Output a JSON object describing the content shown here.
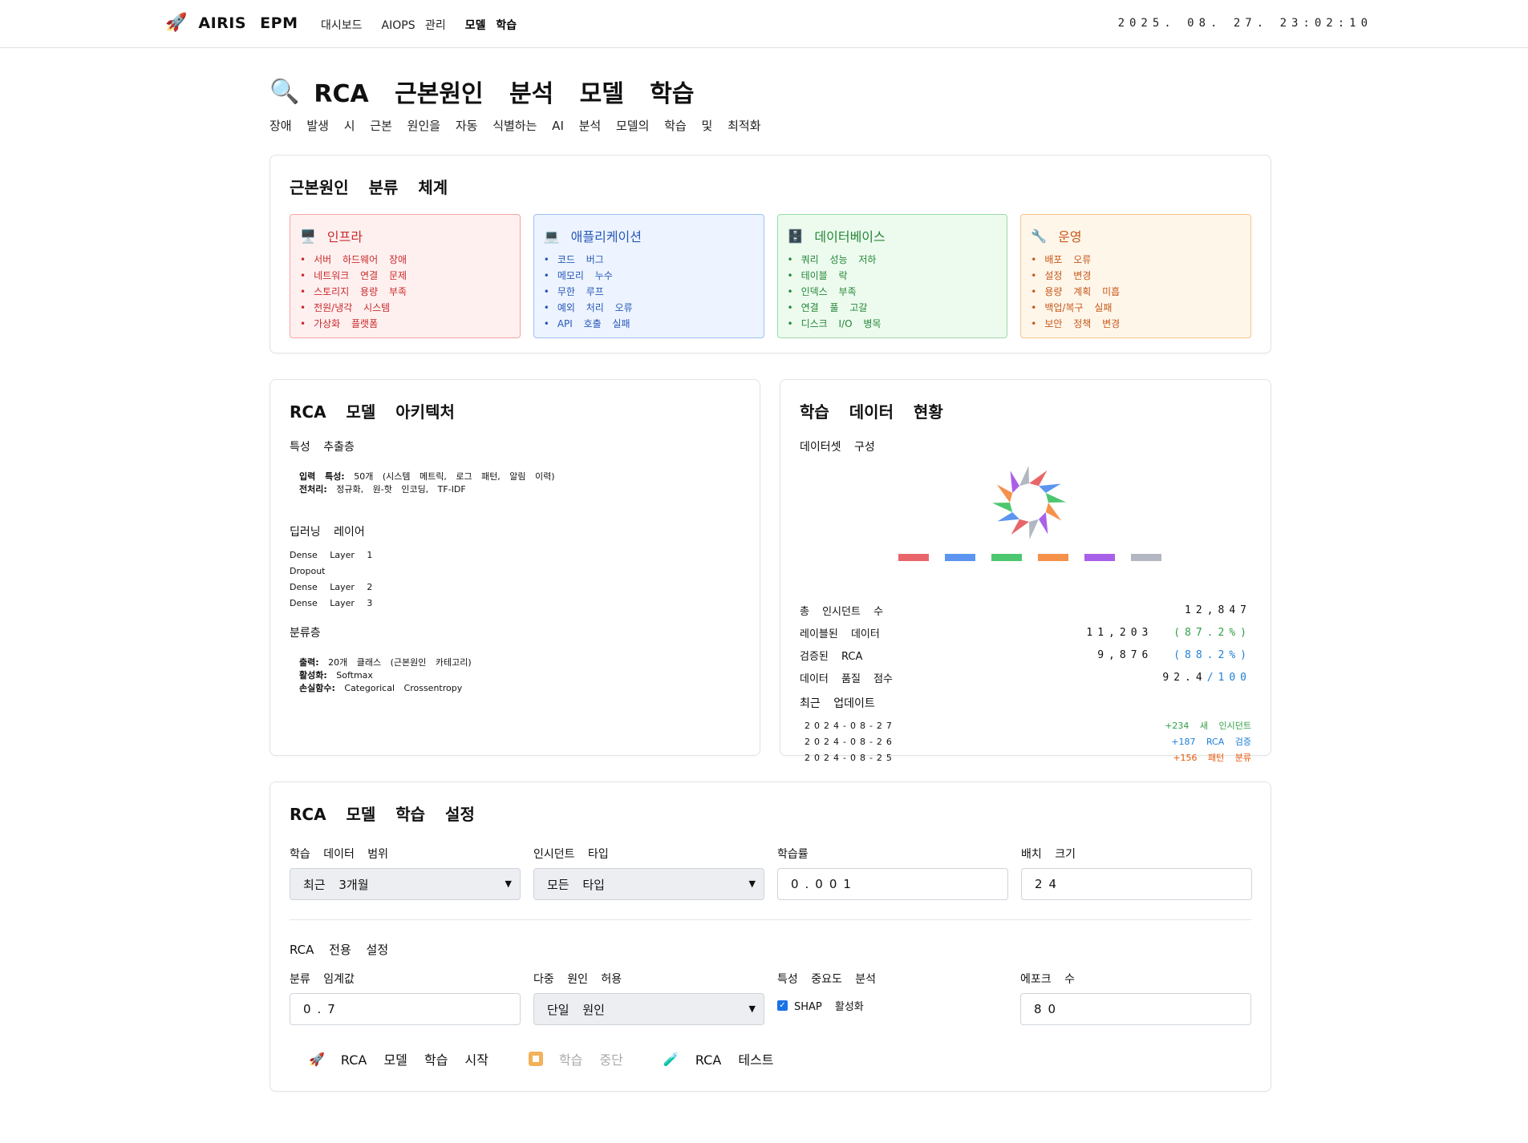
{
  "topbar": {
    "brand": "AIRIS EPM",
    "nav": [
      "대시보드",
      "AIOPS 관리",
      "모델 학습"
    ],
    "clock": "2025. 08. 27. 23:02:10"
  },
  "page": {
    "title": "RCA 근본원인 분석 모델 학습",
    "subtitle": "장애 발생 시 근본 원인을 자동 식별하는 AI 분석 모델의 학습 및 최적화"
  },
  "classification": {
    "title": "근본원인 분류 체계",
    "categories": [
      {
        "name": "인프라",
        "icon": "desktop-icon",
        "items": [
          "서버 하드웨어 장애",
          "네트워크 연결 문제",
          "스토리지 용량 부족",
          "전원/냉각 시스템",
          "가상화 플랫폼"
        ]
      },
      {
        "name": "애플리케이션",
        "icon": "laptop-icon",
        "items": [
          "코드 버그",
          "메모리 누수",
          "무한 루프",
          "예외 처리 오류",
          "API 호출 실패"
        ]
      },
      {
        "name": "데이터베이스",
        "icon": "file-cabinet-icon",
        "items": [
          "쿼리 성능 저하",
          "테이블 락",
          "인덱스 부족",
          "연결 풀 고갈",
          "디스크 I/O 병목"
        ]
      },
      {
        "name": "운영",
        "icon": "wrench-icon",
        "items": [
          "배포 오류",
          "설정 변경",
          "용량 계획 미흡",
          "백업/복구 실패",
          "보안 정책 변경"
        ]
      }
    ]
  },
  "architecture": {
    "title": "RCA 모델 아키텍처",
    "feature_layer": {
      "label": "특성 추출층",
      "input_key": "입력 특성:",
      "input_val": "50개 (시스템 메트릭, 로그 패턴, 알림 이력)",
      "pre_key": "전처리:",
      "pre_val": "정규화, 원-핫 인코딩, TF-IDF"
    },
    "dl_layer": {
      "label": "딥러닝 레이어",
      "layers": [
        "Dense Layer 1",
        "Dropout",
        "Dense Layer 2",
        "Dense Layer 3"
      ]
    },
    "class_layer": {
      "label": "분류층",
      "out_key": "출력:",
      "out_val": "20개 클래스 (근본원인 카테고리)",
      "act_key": "활성화:",
      "act_val": "Softmax",
      "loss_key": "손실함수:",
      "loss_val": "Categorical Crossentropy"
    }
  },
  "dataset": {
    "title": "학습 데이터 현황",
    "composition_label": "데이터셋 구성",
    "stats": [
      {
        "label": "총 인시던트 수",
        "value": "12,847",
        "extra": ""
      },
      {
        "label": "레이블된 데이터",
        "value": "11,203",
        "extra": "(87.2%)"
      },
      {
        "label": "검증된 RCA",
        "value": "9,876",
        "extra": "(88.2%)"
      },
      {
        "label": "데이터 품질 점수",
        "value": "92.4",
        "extra": "/100"
      }
    ],
    "recent_label": "최근 업데이트",
    "recent": [
      {
        "date": "2024-08-27",
        "note": "+234 새 인시던트"
      },
      {
        "date": "2024-08-26",
        "note": "+187 RCA 검증"
      },
      {
        "date": "2024-08-25",
        "note": "+156 패턴 분류"
      }
    ]
  },
  "chart_data": {
    "type": "pie",
    "colors": [
      "#e8666a",
      "#5b95f0",
      "#4cc76f",
      "#f5914a",
      "#a960e8",
      "#b3b7c2"
    ]
  },
  "settings": {
    "title": "RCA 모델 학습 설정",
    "range_label": "학습 데이터 범위",
    "range_value": "최근 3개월",
    "type_label": "인시던트 타입",
    "type_value": "모든 타입",
    "lr_label": "학습률",
    "lr_value": "0.001",
    "batch_label": "배치 크기",
    "batch_value": "24",
    "rca_title": "RCA 전용 설정",
    "threshold_label": "분류 임계값",
    "threshold_value": "0.7",
    "multi_label": "다중 원인 허용",
    "multi_value": "단일 원인",
    "importance_label": "특성 중요도 분석",
    "shap_label": "SHAP 활성화",
    "epoch_label": "에포크 수",
    "epoch_value": "80",
    "start_label": "RCA 모델 학습 시작",
    "stop_label": "학습 중단",
    "test_label": "RCA 테스트"
  }
}
